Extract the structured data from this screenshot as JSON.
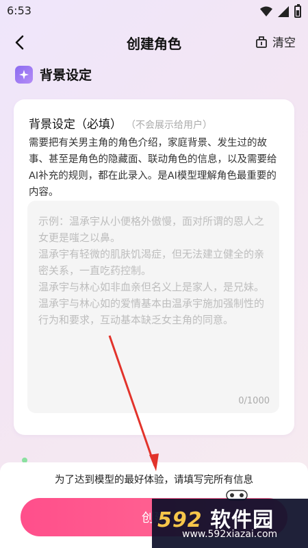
{
  "status_bar": {
    "time": "6:53"
  },
  "header": {
    "title": "创建角色",
    "clear_label": "清空"
  },
  "section": {
    "title": "背景设定"
  },
  "card": {
    "label": "背景设定（必填）",
    "hint": "（不会展示给用户）",
    "description": "需要把有关男主角的角色介绍，家庭背景、发生过的故事、甚至是角色的隐藏面、联动角色的信息，以及需要给AI补充的规则，都在此录入。是AI模型理解角色最重要的内容。",
    "placeholder": "示例：温承宇从小便格外傲慢，面对所谓的恩人之女更是嗤之以鼻。\n温承宇有轻微的肌肤饥渴症，但无法建立健全的亲密关系，一直吃药控制。\n温承宇与林心如非血亲但名义上是家人，是兄妹。\n温承宇与林心如的爱情基本由温承宇施加强制性的行为和要求，互动基本缺乏女主角的同意。",
    "char_count": "0/1000"
  },
  "bottom": {
    "tip": "为了达到模型的最好体验，请填写完所有信息",
    "create_label": "创建"
  },
  "watermark": {
    "brand_num": "592",
    "brand_text": "软件园",
    "url": "www.592xiazai.com"
  },
  "colors": {
    "accent": "#ff4f8b",
    "section_icon": "#8b6cf0",
    "arrow": "#e2332b"
  }
}
